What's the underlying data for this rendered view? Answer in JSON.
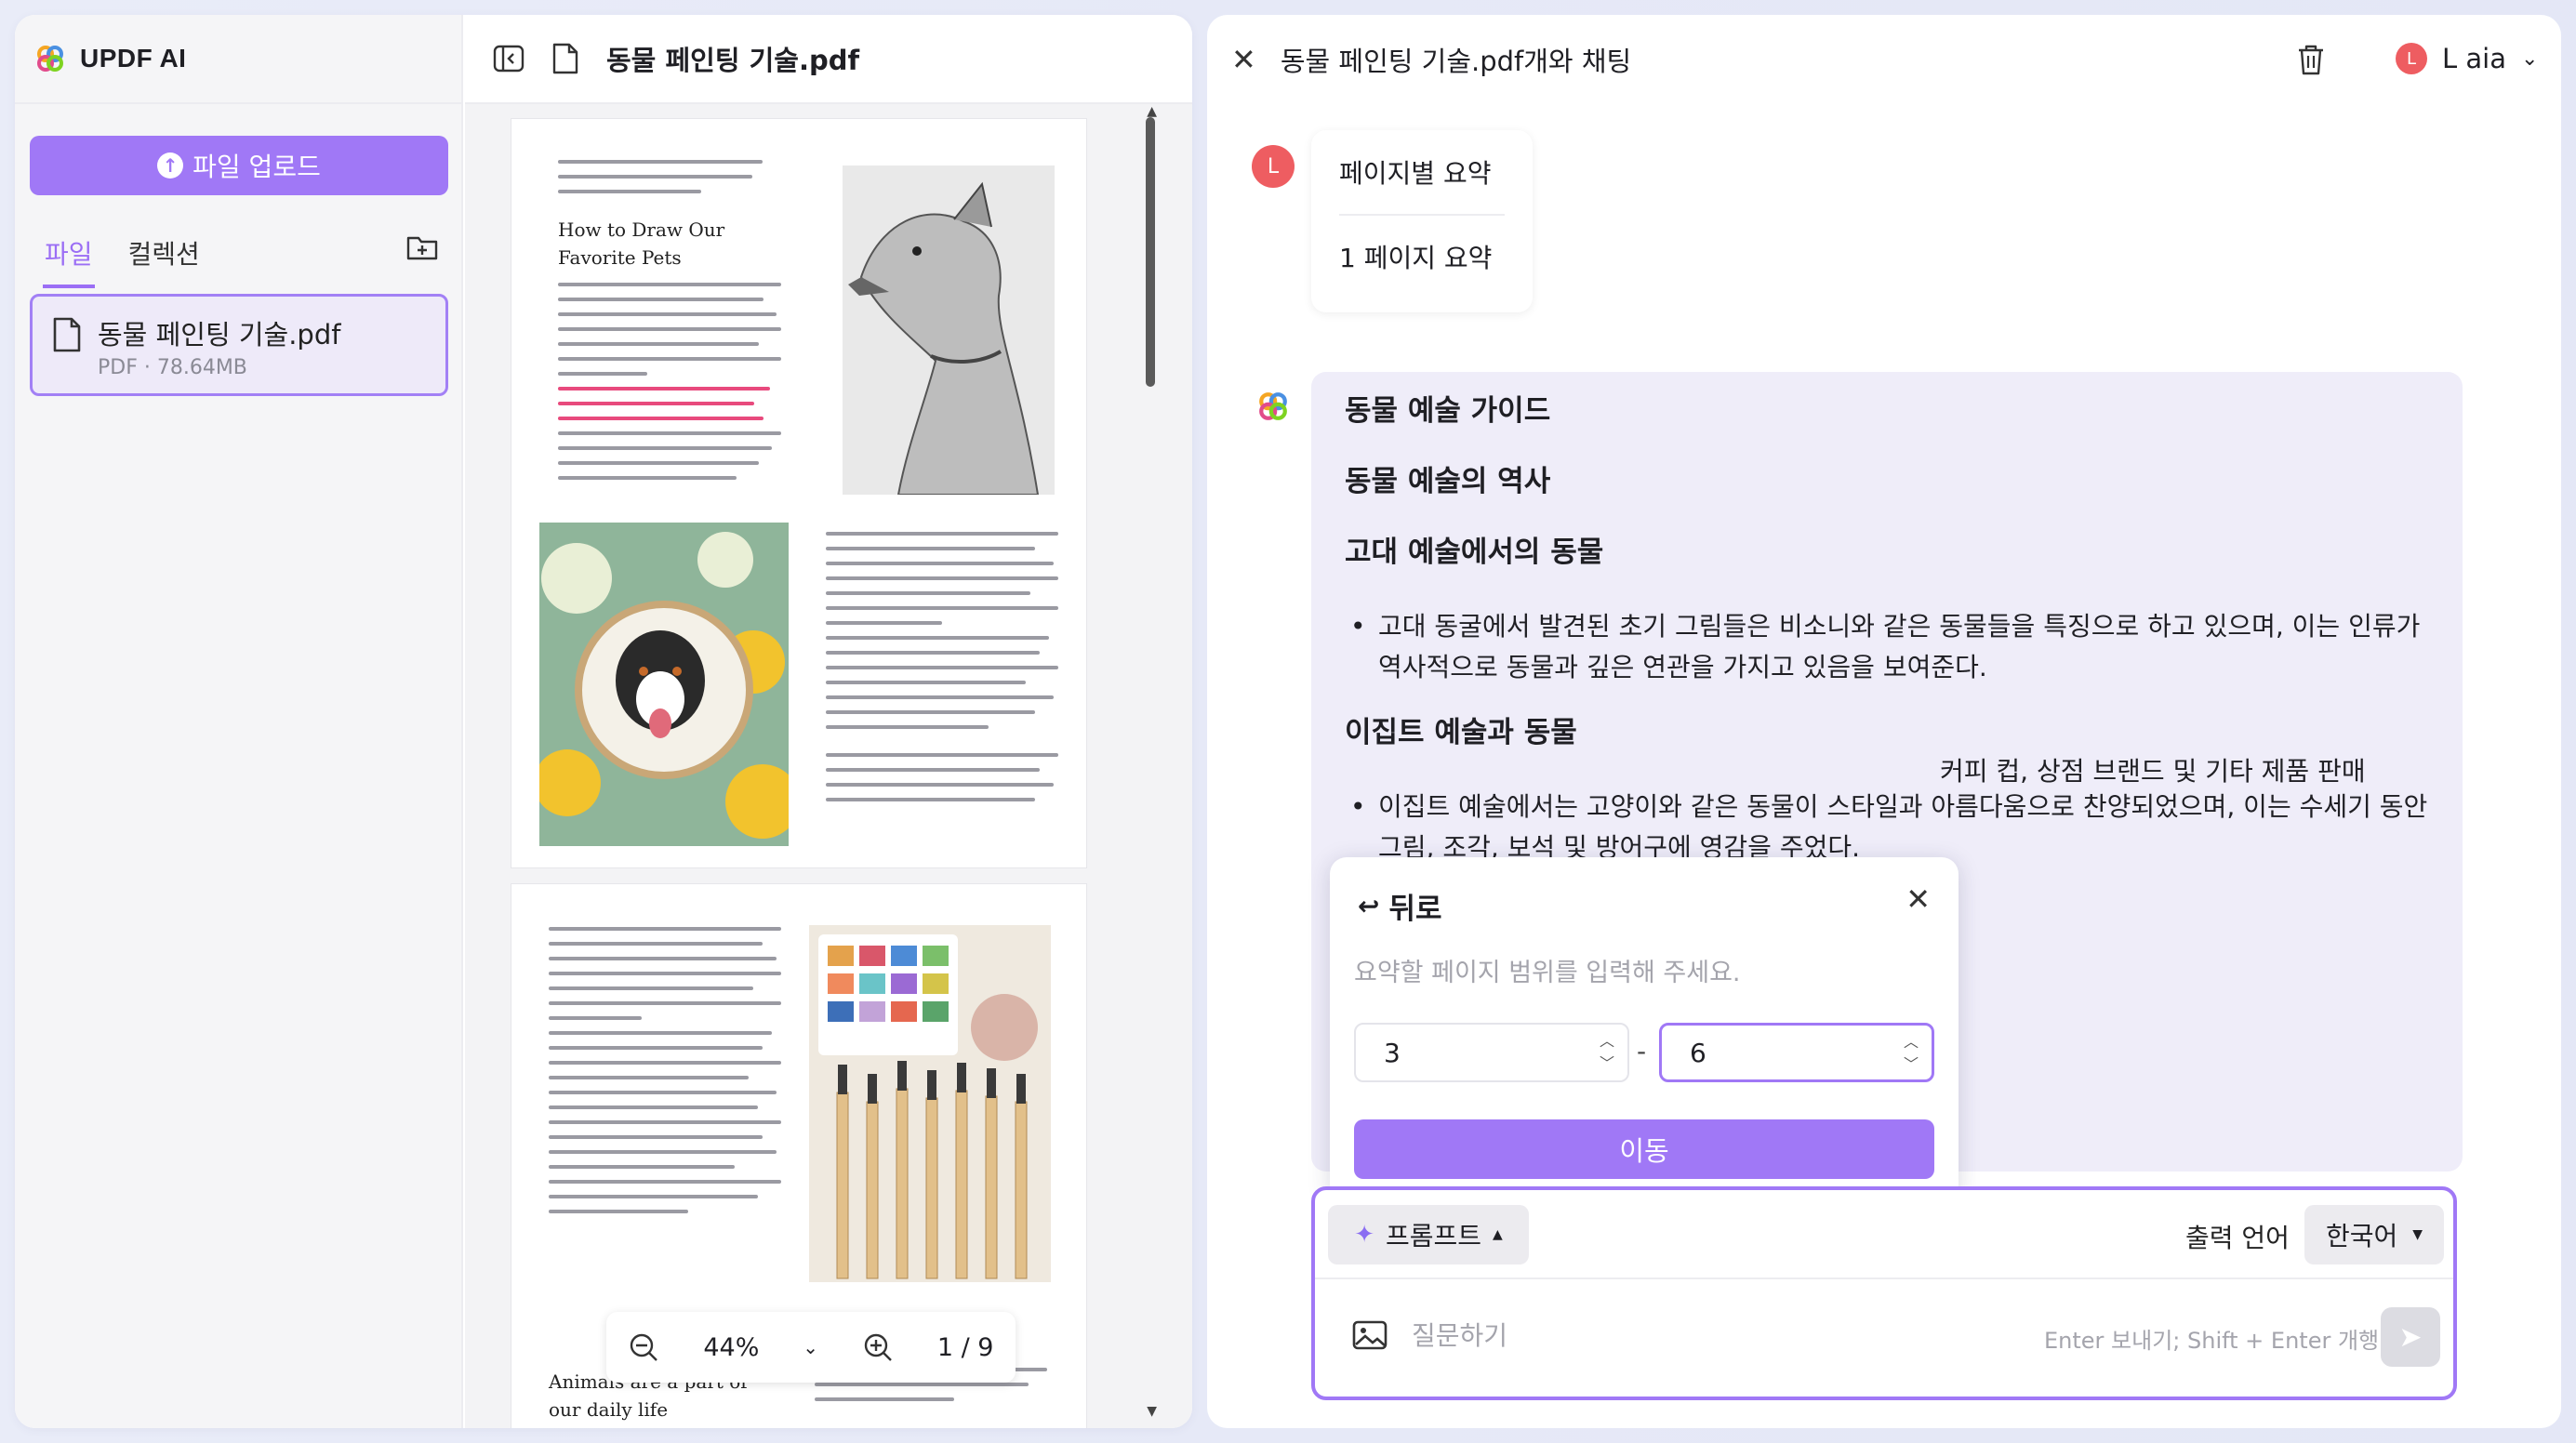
{
  "app": {
    "brand": "UPDF AI"
  },
  "sidebar": {
    "upload_label": "파일 업로드",
    "tabs": [
      {
        "label": "파일"
      },
      {
        "label": "컬렉션"
      }
    ],
    "file": {
      "name": "동물 페인팅 기술.pdf",
      "meta": "PDF · 78.64MB"
    }
  },
  "viewer": {
    "title": "동물 페인팅 기술.pdf",
    "page1_heading": "How to Draw Our\nFavorite Pets",
    "page2_heading": "Animals are a part of\nour daily life",
    "zoom": {
      "level": "44%",
      "page_indicator": "1 / 9"
    }
  },
  "chat": {
    "title": "동물 페인팅 기술.pdf개와 채팅",
    "user": {
      "initial": "L",
      "name": "L aia"
    },
    "user_message": {
      "items": [
        "페이지별 요약",
        "1 페이지 요약"
      ]
    },
    "answer": {
      "h1": "동물 예술 가이드",
      "h2": "동물 예술의 역사",
      "h3": "고대 예술에서의 동물",
      "p1": "고대 동굴에서 발견된 초기 그림들은 비소니와 같은 동물들을 특징으로 하고 있으며, 이는 인류가 역사적으로 동물과 깊은 연관을 가지고 있음을 보여준다.",
      "h4": "이집트 예술과 동물",
      "p2": "이집트 예술에서는 고양이와 같은 동물이 스타일과 아름다움으로 찬양되었으며, 이는 수세기 동안 그림, 조각, 보석 및 방어구에 영감을 주었다.",
      "p3_tail": "커피 컵, 상점 브랜드 및 기타 제품 판매"
    },
    "popup": {
      "back_label": "뒤로",
      "hint": "요약할 페이지 범위를 입력해 주세요.",
      "from": "3",
      "to": "6",
      "go_label": "이동"
    },
    "composer": {
      "prompt_label": "프롬프트",
      "output_lang_label": "출력 언어",
      "lang": "한국어",
      "placeholder": "질문하기",
      "hint": "Enter 보내기; Shift + Enter 개행"
    }
  },
  "colors": {
    "accent": "#a078f6",
    "avatar": "#ee5d61"
  }
}
